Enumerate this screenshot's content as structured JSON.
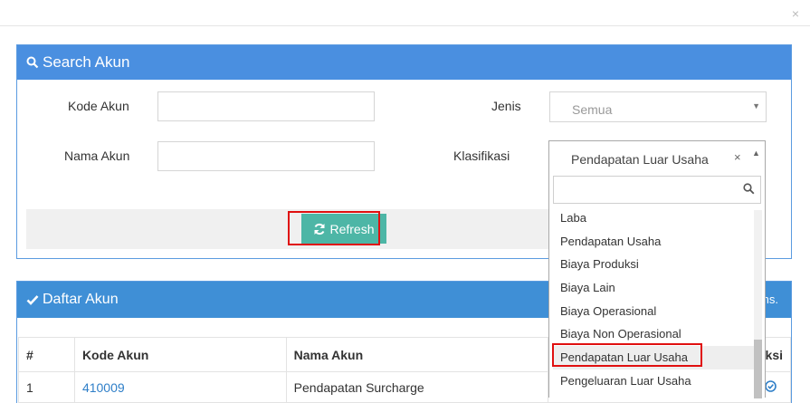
{
  "modal": {
    "close_icon": "×"
  },
  "search_panel": {
    "title": "Search Akun",
    "kode_label": "Kode Akun",
    "nama_label": "Nama Akun",
    "jenis_label": "Jenis",
    "jenis_value": "Semua",
    "klasifikasi_label": "Klasifikasi",
    "refresh_label": "Refresh"
  },
  "dropdown": {
    "selected": "Pendapatan Luar Usaha",
    "clear_icon": "×",
    "options": [
      "Laba",
      "Pendapatan Usaha",
      "Biaya Produksi",
      "Biaya Lain",
      "Biaya Operasional",
      "Biaya Non Operasional",
      "Pendapatan Luar Usaha",
      "Pengeluaran Luar Usaha"
    ],
    "highlighted": "Pendapatan Luar Usaha"
  },
  "list_panel": {
    "title": "Daftar Akun",
    "right_text": "ns.",
    "columns": [
      "#",
      "Kode Akun",
      "Nama Akun",
      "ksi"
    ],
    "rows": [
      {
        "no": "1",
        "kode": "410009",
        "nama": "Pendapatan Surcharge"
      }
    ]
  },
  "colors": {
    "header_blue": "#4a8fe0",
    "refresh_green": "#4db6a6",
    "highlight_red": "#e01010"
  }
}
